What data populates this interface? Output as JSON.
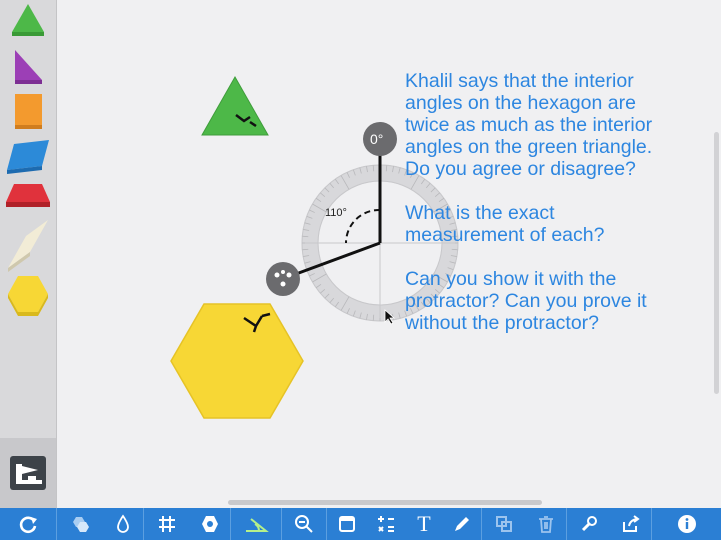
{
  "sidebar": {
    "items": [
      {
        "name": "green-triangle",
        "color": "#4db848"
      },
      {
        "name": "purple-right-triangle",
        "color": "#9c3fb6"
      },
      {
        "name": "orange-square",
        "color": "#f39a2e"
      },
      {
        "name": "blue-rhombus",
        "color": "#2c8ad8"
      },
      {
        "name": "red-trapezoid",
        "color": "#e0323c"
      },
      {
        "name": "tan-thin-rhombus",
        "color": "#f2ecd6"
      },
      {
        "name": "yellow-hexagon",
        "color": "#f7d735"
      }
    ]
  },
  "workspace": {
    "question": {
      "p1": "Khalil says that the interior\nangles on the hexagon are\ntwice as much as the interior\nangles on the green triangle.\nDo you agree or disagree?",
      "p2": "What is the exact\nmeasurement of each?",
      "p3": "Can you show it with the\nprotractor? Can you prove it\nwithout the protractor?"
    },
    "protractor": {
      "zero_label": "0°",
      "angle_label": "110°",
      "angle_value": 110
    },
    "colors": {
      "triangle": "#4db848",
      "hexagon": "#f7d735",
      "text": "#2d86e0"
    }
  },
  "toolbar": {
    "buttons": [
      "refresh-icon",
      "hexagons-icon",
      "color-drop-icon",
      "grid-icon",
      "snap-icon",
      "angle-tool-icon",
      "zoom-out-icon",
      "screen-icon",
      "calculator-icon",
      "text-icon",
      "pencil-icon",
      "duplicate-icon",
      "trash-icon",
      "wrench-icon",
      "share-icon",
      "info-icon"
    ],
    "text_tool_label": "T",
    "accent": "#2b7fd4"
  }
}
